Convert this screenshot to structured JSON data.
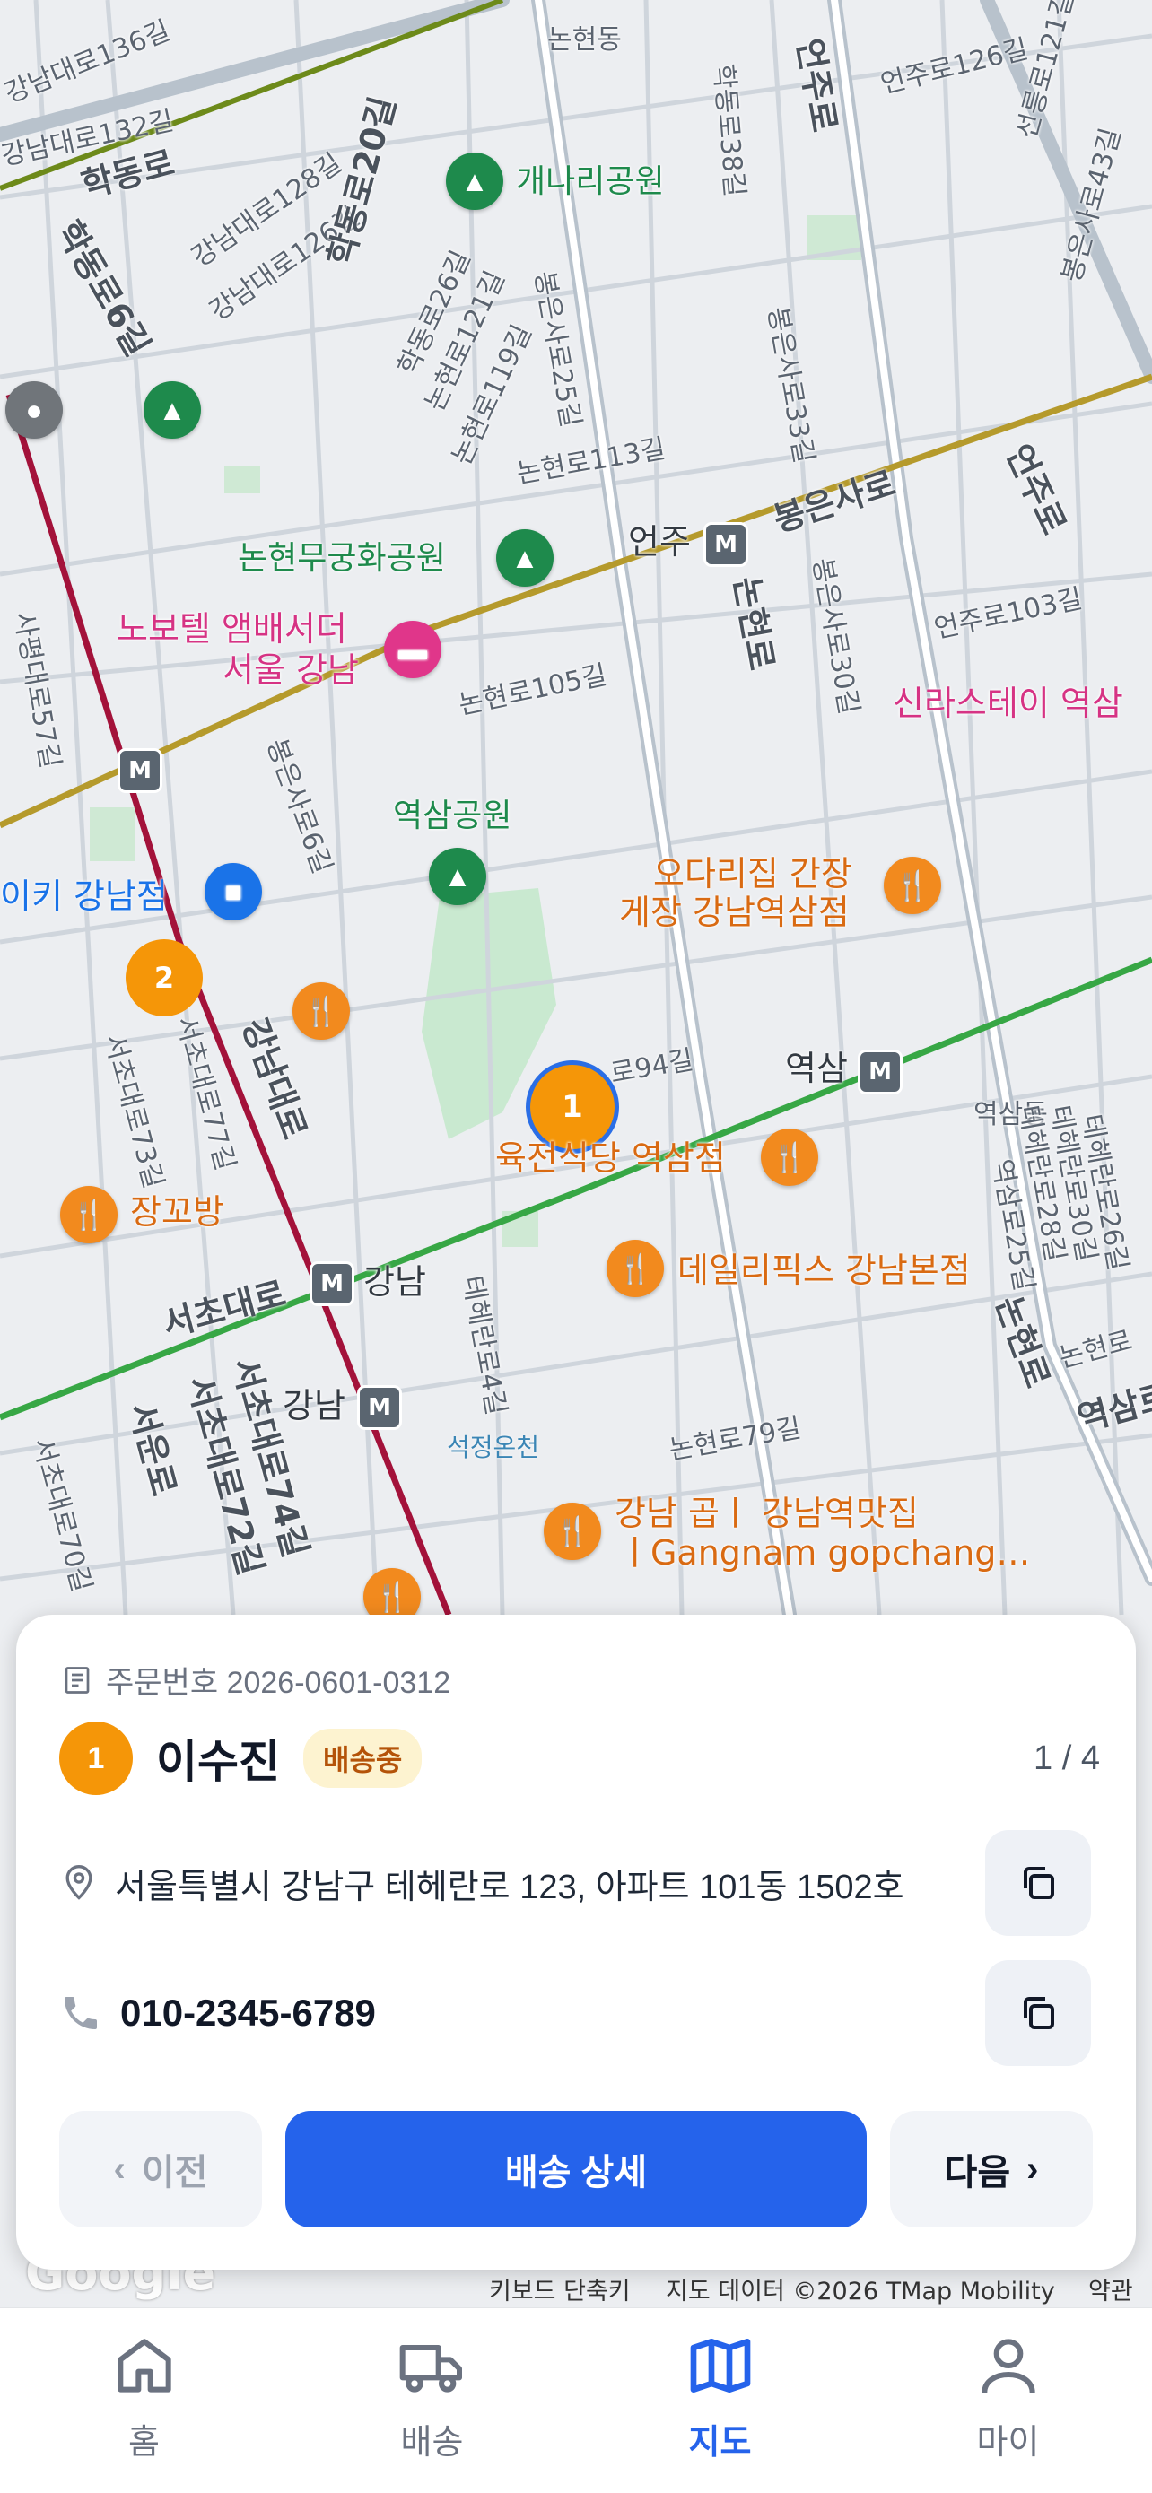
{
  "map": {
    "labels": {
      "nonhyeon_dong": "논현동",
      "hakdong_ro38": "학동로38길",
      "eonju_ro_top": "언주로",
      "eonju_ro126": "언주로126길",
      "seolleung_ro121": "선릉로121길",
      "bongeunsa_ro43": "봉은사로43길",
      "gangnam_daero136": "강남대로136길",
      "gangnam_daero132": "강남대로132길",
      "hakdong_ro": "학동로",
      "gangnam_daero128": "강남대로128길",
      "gangnam_daero126": "강남대로126길",
      "hakdong_ro20": "학동로20길",
      "hakdong_ro6": "학동로6길",
      "gaenari_park": "개나리공원",
      "hakdong_ro26": "학동로26길",
      "nonhyeon_ro121": "논현로121길",
      "nonhyeon_ro119": "논현로119길",
      "bongeunsa_ro25": "봉은사로25길",
      "bongeunsa_ro33": "봉은사로33길",
      "nonhyeon_ro113": "논현로113길",
      "eonju_ro_right": "언주로",
      "nonhyeon_mugunghwa_park": "논현무궁화공원",
      "eonju_station": "언주",
      "bongeunsa_ro": "봉은사로",
      "bongeunsa_ro30": "봉은사로30길",
      "nonhyeon_ro_mid": "논현로",
      "eonju_ro103": "언주로103길",
      "novotel_1": "노보텔 앰배서더",
      "novotel_2": "서울 강남",
      "nonhyeon_ro105": "논현로105길",
      "shilla_stay": "신라스테이 역삼",
      "sapyeong_daero57": "사평대로57길",
      "bongeunsa_ro6": "봉은사로6길",
      "yeoksam_park": "역삼공원",
      "odari_1": "오다리집 간장",
      "odari_2": "게장 강남역삼점",
      "ikki_gangnam": "이키 강남점",
      "seocho_daero73": "서초대로73길",
      "seocho_daero77": "서초대로77길",
      "gangnam_daero": "강남대로",
      "ro94": "로94길",
      "yeoksam_station": "역삼",
      "yeoksam_dong": "역삼동",
      "yukjeon_sikdang": "육전식당 역삼점",
      "teheran_ro26": "테헤란로26길",
      "teheran_ro30": "테헤란로30길",
      "teheran_ro28": "테헤란로28길",
      "yeoksam_ro25": "역삼로25길",
      "jangggobang": "장꼬방",
      "seocho_daero": "서초대로",
      "gangnam_station": "강남",
      "teheran_ro4": "테헤란로4길",
      "daily_pix": "데일리픽스 강남본점",
      "nonhyeon_ro_low": "논현로",
      "nonhyeon_ro_low2": "논현로",
      "yeoksam_right": "역삼로",
      "gangnam_station2": "강남",
      "seocho_daero74": "서초대로74길",
      "seocho_daero72": "서초대로72길",
      "seoun_ro": "서운로",
      "seocho_daero70": "서초대로70길",
      "seokjeong_stream": "석정온천",
      "nonhyeon_ro79": "논현로79길",
      "gopchang_1": "강남 곱ㅣ 강남역맛집",
      "gopchang_2": "ㅣGangnam gopchang…"
    },
    "clusters": {
      "c1": "1",
      "c2": "2"
    },
    "google_logo": "Google",
    "attribution": {
      "shortcuts": "키보드 단축키",
      "data": "지도 데이터 ©2026 TMap Mobility",
      "terms": "약관"
    },
    "colors": {
      "line2": "#37a745",
      "line9": "#b59a2c",
      "sinbundang": "#a3123a"
    }
  },
  "card": {
    "order_label": "주문번호 2026-0601-0312",
    "seq": "1",
    "name": "이수진",
    "status": "배송중",
    "counter": "1 / 4",
    "address": "서울특별시 강남구 테헤란로 123, 아파트 101동 1502호",
    "phone": "010-2345-6789",
    "prev": "이전",
    "detail": "배송 상세",
    "next": "다음",
    "colors": {
      "primary": "#2563eb",
      "badge_bg": "#fdf3d0",
      "badge_fg": "#b45309",
      "seq": "#f59608"
    }
  },
  "tabbar": {
    "tabs": [
      {
        "label": "홈",
        "icon": "home-icon"
      },
      {
        "label": "배송",
        "icon": "truck-icon"
      },
      {
        "label": "지도",
        "icon": "map-icon"
      },
      {
        "label": "마이",
        "icon": "user-icon"
      }
    ],
    "active": "지도"
  }
}
